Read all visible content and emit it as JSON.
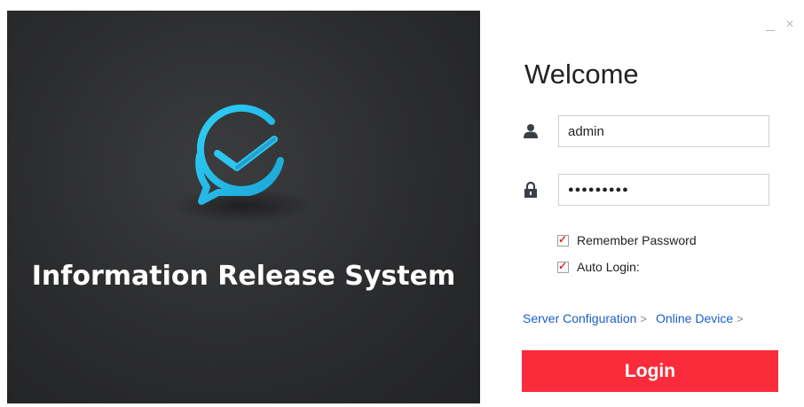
{
  "brand": {
    "title": "Information Release System",
    "logo_icon": "chat-bubble-check-logo",
    "accent_color": "#29c5f2"
  },
  "window": {
    "minimize_label": "_",
    "close_label": "×"
  },
  "login": {
    "welcome": "Welcome",
    "username_icon": "user-icon",
    "username_value": "admin",
    "password_icon": "lock-icon",
    "password_display": "●●●●●●●●●",
    "remember_password": {
      "label": "Remember Password",
      "checked": true
    },
    "auto_login": {
      "label": "Auto Login:",
      "checked": true
    },
    "check_mark": "✓",
    "server_config_label": "Server Configuration",
    "online_device_label": "Online Device",
    "link_chevron": ">",
    "login_button": "Login",
    "button_color": "#fa2c3b",
    "link_color": "#1b5ec8"
  }
}
